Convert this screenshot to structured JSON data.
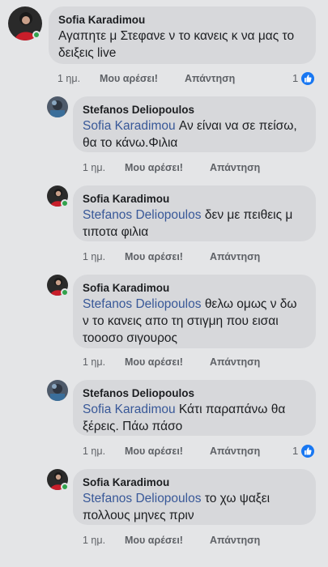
{
  "comments": [
    {
      "author": "Sofia Karadimou",
      "mention": "",
      "text": "Αγαπητε μ Στεφανε ν το κανεις κ να μας το δειξεις live",
      "time": "1 ημ.",
      "like_label": "Μου αρέσει!",
      "reply_label": "Απάντηση",
      "reaction_count": "1"
    },
    {
      "author": "Stefanos Deliopoulos",
      "mention": "Sofia Karadimou",
      "text": "Αν είναι να σε πείσω, θα το κάνω.Φιλια",
      "time": "1 ημ.",
      "like_label": "Μου αρέσει!",
      "reply_label": "Απάντηση"
    },
    {
      "author": "Sofia Karadimou",
      "mention": "Stefanos Deliopoulos",
      "text": "δεν με πειθεις μ τιποτα φιλια",
      "time": "1 ημ.",
      "like_label": "Μου αρέσει!",
      "reply_label": "Απάντηση"
    },
    {
      "author": "Sofia Karadimou",
      "mention": "Stefanos Deliopoulos",
      "text": "θελω ομως ν δω ν το κανεις απο τη στιγμη που εισαι τοοοσο σιγουρος",
      "time": "1 ημ.",
      "like_label": "Μου αρέσει!",
      "reply_label": "Απάντηση"
    },
    {
      "author": "Stefanos Deliopoulos",
      "mention": "Sofia Karadimou",
      "text": "Κάτι παραπάνω θα ξέρεις. Πάω πάσο",
      "time": "1 ημ.",
      "like_label": "Μου αρέσει!",
      "reply_label": "Απάντηση",
      "reaction_count": "1"
    },
    {
      "author": "Sofia Karadimou",
      "mention": "Stefanos Deliopoulos",
      "text": "το χω ψαξει πολλους μηνες πριν",
      "time": "1 ημ.",
      "like_label": "Μου αρέσει!",
      "reply_label": "Απάντηση"
    }
  ],
  "icons": {
    "reaction": "like-thumb-icon",
    "presence": "online-status-dot"
  },
  "colors": {
    "background": "#e4e5e7",
    "bubble": "#d7d8db",
    "mention": "#385898",
    "like": "#1877f2",
    "online": "#31a24c"
  }
}
